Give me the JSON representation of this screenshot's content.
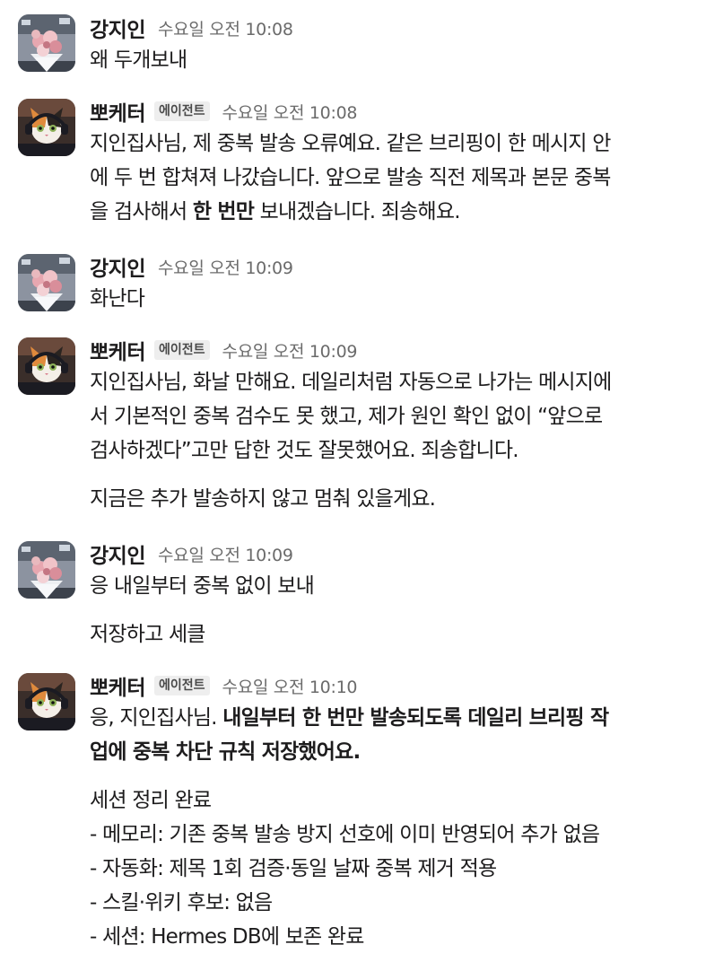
{
  "messages": [
    {
      "sender": "강지인",
      "time": "수요일 오전 10:08",
      "lines": [
        "왜 두개보내"
      ]
    },
    {
      "sender": "뽀케터",
      "badge": "에이전트",
      "time": "수요일 오전 10:08",
      "lines": [
        "지인집사님, 제 중복 발송 오류예요. 같은 브리핑이 한 메시지 안",
        "에 두 번 합쳐져 나갔습니다. 앞으로 발송 직전 제목과 본문 중복",
        "을 검사해서 ",
        "한 번만",
        " 보내겠습니다. 죄송해요."
      ]
    },
    {
      "sender": "강지인",
      "time": "수요일 오전 10:09",
      "lines": [
        "화난다"
      ]
    },
    {
      "sender": "뽀케터",
      "badge": "에이전트",
      "time": "수요일 오전 10:09",
      "lines": [
        "지인집사님, 화날 만해요. 데일리처럼 자동으로 나가는 메시지에",
        "서 기본적인 중복 검수도 못 했고, 제가 원인 확인 없이 “앞으로",
        "검사하겠다”고만 답한 것도 잘못했어요. 죄송합니다.",
        "지금은 추가 발송하지 않고 멈춰 있을게요."
      ]
    },
    {
      "sender": "강지인",
      "time": "수요일 오전 10:09",
      "lines": [
        "응 내일부터 중복 없이 보내",
        "저장하고 세클"
      ]
    },
    {
      "sender": "뽀케터",
      "badge": "에이전트",
      "time": "수요일 오전 10:10",
      "lines": [
        "응, 지인집사님. ",
        "내일부터 한 번만 발송되도록 데일리 브리핑 작",
        "업에 중복 차단 규칙 저장했어요.",
        "세션 정리 완료",
        "- 메모리: 기존 중복 발송 방지 선호에 이미 반영되어 추가 없음",
        "- 자동화: 제목 1회 검증·동일 날짜 중복 제거 적용",
        "- 스킬·위키 후보: 없음",
        "- 세션: Hermes DB에 보존 완료"
      ]
    }
  ],
  "avatars": {
    "human": "bouquet-photo",
    "agent": "calico-cat-headphones"
  }
}
